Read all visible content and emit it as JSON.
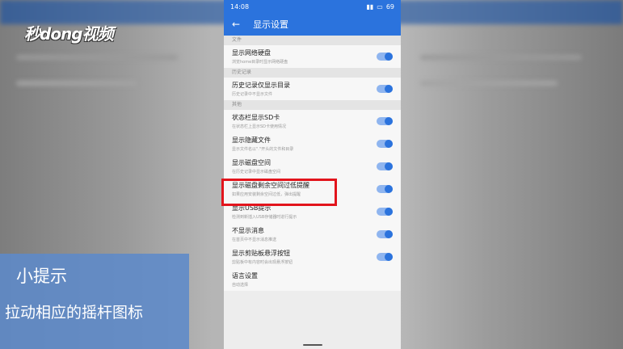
{
  "watermark": "秒dong视频",
  "status": {
    "time": "14:08",
    "battery": "69"
  },
  "appbar": {
    "back_icon": "←",
    "title": "显示设置"
  },
  "sections": [
    {
      "header": "文件",
      "items": [
        {
          "label": "显示网络硬盘",
          "desc": "浏览home目录时显示网络硬盘",
          "toggle": true
        }
      ]
    },
    {
      "header": "历史记录",
      "items": [
        {
          "label": "历史记录仅显示目录",
          "desc": "历史记录中不显示文件",
          "toggle": true
        }
      ]
    },
    {
      "header": "其他",
      "items": [
        {
          "label": "状态栏显示SD卡",
          "desc": "在状态栏上显示SD卡使用情况",
          "toggle": true
        },
        {
          "label": "显示隐藏文件",
          "desc": "显示文件名以\".\"开头的文件和目录",
          "toggle": true
        },
        {
          "label": "显示磁盘空间",
          "desc": "在历史记录中显示磁盘空间",
          "toggle": true
        },
        {
          "label": "显示磁盘剩余空间过低提醒",
          "desc": "如果应用安装剩余空间过低，弹出提醒",
          "toggle": true
        },
        {
          "label": "显示USB提示",
          "desc": "检测到新插入USB存储器时进行提示",
          "toggle": true
        },
        {
          "label": "不显示消息",
          "desc": "在首页中不显示消息推送",
          "toggle": true
        },
        {
          "label": "显示剪贴板悬浮按钮",
          "desc": "剪贴板中有内容时会出现悬浮按钮",
          "toggle": true
        },
        {
          "label": "语言设置",
          "desc": "自动选择",
          "toggle": false
        }
      ]
    }
  ],
  "tip": {
    "title": "小提示",
    "body": "拉动相应的摇杆图标"
  },
  "colors": {
    "accent": "#2b73dd",
    "highlight": "#e2141c",
    "tip_bg": "#5d8ac9"
  }
}
